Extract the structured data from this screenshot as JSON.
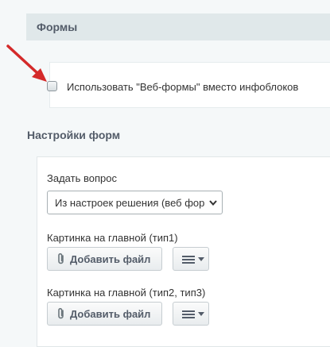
{
  "forms_section": {
    "header": "Формы",
    "use_webforms_label": "Использовать \"Веб-формы\" вместо инфоблоков",
    "use_webforms_checked": false
  },
  "settings": {
    "title": "Настройки форм",
    "ask_question_label": "Задать вопрос",
    "ask_question_value": "Из настроек решения (веб формы)",
    "picture_main_type1_label": "Картинка на главной (тип1)",
    "picture_main_type23_label": "Картинка на главной (тип2, тип3)",
    "add_file_label": "Добавить файл"
  },
  "colors": {
    "page_bg": "#f5f8f9",
    "header_bg": "#e0e8ea",
    "arrow": "#d42a2a"
  },
  "icons": {
    "attach": "paperclip-icon",
    "menu": "menu-lines-icon",
    "dropdown": "chevron-down-icon",
    "annotation": "red-arrow-icon"
  }
}
